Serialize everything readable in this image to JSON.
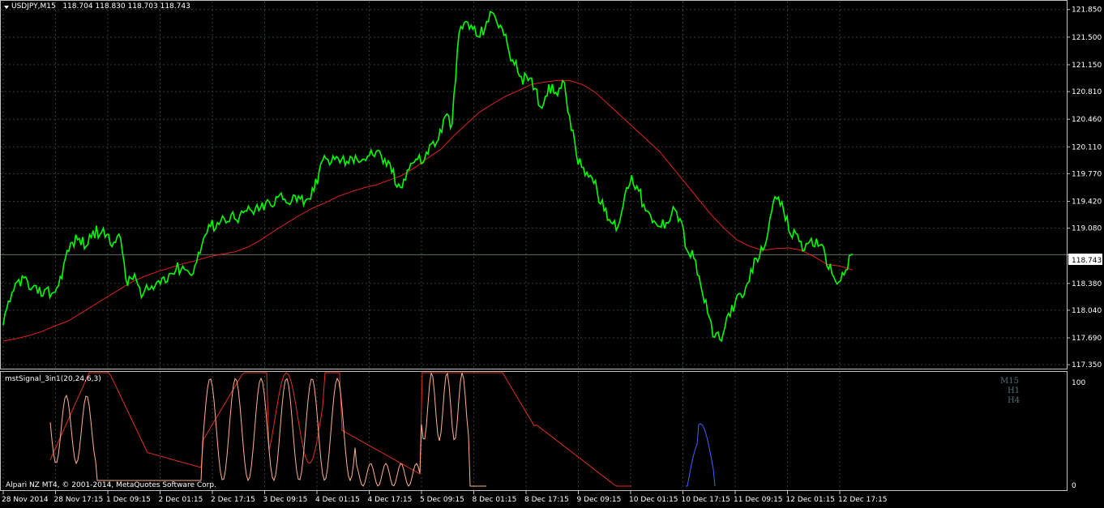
{
  "header": {
    "menu_icon": "triangle-down-icon",
    "symbol": "USDJPY,M15",
    "open": "118.704",
    "high": "118.830",
    "low": "118.703",
    "close": "118.743"
  },
  "indicator": {
    "label": "mstSignal_3in1(20,24,6,3)",
    "timeframe_labels": [
      "M15",
      "H1",
      "H4"
    ],
    "y_labels": [
      "100",
      "0"
    ]
  },
  "footer_note": "Alpari NZ MT4, © 2001-2014, MetaQuotes Software Corp.",
  "colors": {
    "background": "#000000",
    "grid": "#3a4a3a",
    "price_line": "#00ff00",
    "moving_average": "#e02020",
    "signal_m15": "#ffb090",
    "signal_h1": "#e03020",
    "signal_h4": "#4060ff",
    "current_price_line": "#607060",
    "timeframe_label": "#4f6f73"
  },
  "chart_data": {
    "type": "line",
    "title": "USDJPY,M15",
    "current_price": "118.743",
    "y_tick_labels": [
      "121.850",
      "121.500",
      "121.150",
      "120.810",
      "120.460",
      "120.110",
      "119.770",
      "119.420",
      "119.080",
      "118.743",
      "118.380",
      "118.040",
      "117.690",
      "117.350"
    ],
    "x_tick_labels": [
      "28 Nov 2014",
      "28 Nov 17:15",
      "1 Dec 09:15",
      "2 Dec 01:15",
      "2 Dec 17:15",
      "3 Dec 09:15",
      "4 Dec 01:15",
      "4 Dec 17:15",
      "5 Dec 09:15",
      "8 Dec 01:15",
      "8 Dec 17:15",
      "9 Dec 09:15",
      "10 Dec 01:15",
      "10 Dec 17:15",
      "11 Dec 09:15",
      "12 Dec 01:15",
      "12 Dec 17:15"
    ],
    "ylim": [
      117.3,
      121.95
    ],
    "series": [
      {
        "role": "price",
        "values": [
          117.85,
          118.15,
          118.4,
          118.45,
          118.3,
          118.25,
          118.3,
          118.25,
          118.35,
          118.7,
          118.9,
          118.95,
          118.85,
          119.05,
          119.0,
          119.0,
          118.9,
          118.95,
          118.35,
          118.5,
          118.2,
          118.3,
          118.35,
          118.45,
          118.5,
          118.55,
          118.6,
          118.5,
          118.65,
          118.95,
          119.1,
          119.15,
          119.2,
          119.25,
          119.15,
          119.3,
          119.3,
          119.3,
          119.4,
          119.35,
          119.5,
          119.4,
          119.5,
          119.45,
          119.45,
          119.55,
          119.9,
          119.95,
          119.95,
          119.95,
          119.9,
          120.0,
          119.95,
          120.0,
          120.05,
          119.9,
          119.9,
          119.6,
          119.7,
          119.9,
          119.95,
          119.95,
          120.15,
          120.2,
          120.5,
          120.4,
          121.55,
          121.7,
          121.6,
          121.5,
          121.7,
          121.8,
          121.65,
          121.4,
          121.15,
          121.0,
          120.95,
          120.85,
          120.6,
          120.9,
          120.8,
          120.95,
          120.5,
          120.0,
          119.85,
          119.75,
          119.55,
          119.3,
          119.15,
          119.1,
          119.5,
          119.75,
          119.55,
          119.3,
          119.15,
          119.1,
          119.15,
          119.35,
          119.2,
          118.8,
          118.7,
          118.35,
          118.0,
          117.7,
          117.65,
          118.0,
          118.15,
          118.2,
          118.4,
          118.7,
          118.8,
          119.2,
          119.45,
          119.3,
          119.0,
          119.0,
          118.8,
          118.95,
          118.85,
          118.75,
          118.5,
          118.4,
          118.55,
          118.75
        ]
      },
      {
        "role": "moving-average",
        "values": [
          117.65,
          117.68,
          117.72,
          117.77,
          117.84,
          117.9,
          118.0,
          118.1,
          118.2,
          118.3,
          118.4,
          118.47,
          118.53,
          118.58,
          118.63,
          118.67,
          118.72,
          118.75,
          118.78,
          118.84,
          118.93,
          119.04,
          119.14,
          119.24,
          119.33,
          119.4,
          119.48,
          119.54,
          119.59,
          119.63,
          119.69,
          119.75,
          119.85,
          119.97,
          120.08,
          120.25,
          120.4,
          120.55,
          120.65,
          120.75,
          120.82,
          120.9,
          120.93,
          120.95,
          120.95,
          120.9,
          120.8,
          120.65,
          120.5,
          120.35,
          120.2,
          120.05,
          119.85,
          119.65,
          119.45,
          119.25,
          119.08,
          118.93,
          118.85,
          118.8,
          118.82,
          118.83,
          118.8,
          118.72,
          118.62,
          118.6,
          118.55
        ]
      }
    ]
  }
}
